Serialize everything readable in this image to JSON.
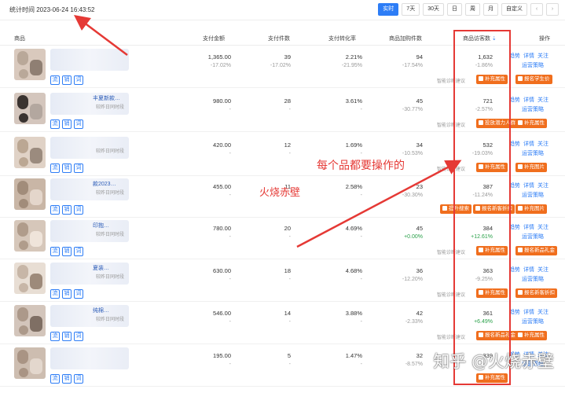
{
  "header": {
    "stat_time": "统计时间 2023-06-24 16:43:52",
    "tabs": [
      "实时",
      "7天",
      "30天",
      "日",
      "周",
      "月",
      "自定义"
    ],
    "active_tab": "实时"
  },
  "table": {
    "columns": [
      "商品",
      "支付金额",
      "支付件数",
      "支付转化率",
      "商品加购件数",
      "商品访客数",
      "操作"
    ]
  },
  "rows": [
    {
      "name": "",
      "desc": "",
      "amount": "1,365.00",
      "amount_chg": "-17.02%",
      "count": "39",
      "count_chg": "-17.02%",
      "rate": "2.21%",
      "rate_chg": "-21.95%",
      "cart": "94",
      "cart_chg": "-17.54%",
      "visitors": "1,632",
      "visitors_chg": "-1.86%",
      "suggest_label": "智能诊断建议",
      "btn1": "补充属性",
      "btn2": "报名学生价",
      "ops": [
        "趋势",
        "详情",
        "关注"
      ],
      "ops2": "运营策略"
    },
    {
      "name": "丰夏新款…",
      "desc": "较昨日同时段",
      "amount": "980.00",
      "amount_chg": "-",
      "count": "28",
      "count_chg": "-",
      "rate": "3.61%",
      "rate_chg": "-",
      "cart": "45",
      "cart_chg": "-30.77%",
      "visitors": "721",
      "visitors_chg": "-2.57%",
      "suggest_label": "智能诊断建议",
      "btn1": "投放潜力人群",
      "btn2": "补充属性",
      "ops": [
        "趋势",
        "详情",
        "关注"
      ],
      "ops2": "运营策略"
    },
    {
      "name": "",
      "desc": "较昨日同时段",
      "amount": "420.00",
      "amount_chg": "-",
      "count": "12",
      "count_chg": "-",
      "rate": "1.69%",
      "rate_chg": "-",
      "cart": "34",
      "cart_chg": "-10.53%",
      "visitors": "532",
      "visitors_chg": "-19.03%",
      "suggest_label": "智能诊断建议",
      "btn1": "补充属性",
      "btn2": "补充图片",
      "ops": [
        "趋势",
        "详情",
        "关注"
      ],
      "ops2": "运营策略"
    },
    {
      "name": "款2023…",
      "desc": "较昨日同时段",
      "amount": "455.00",
      "amount_chg": "-",
      "count": "11",
      "count_chg": "-",
      "rate": "2.58%",
      "rate_chg": "-",
      "cart": "23",
      "cart_chg": "-30.30%",
      "visitors": "387",
      "visitors_chg": "-11.24%",
      "suggest_label": "",
      "btn1": "提升搜索",
      "btn2": "报名新客折扣",
      "btn3": "补充图片",
      "ops": [
        "趋势",
        "详情",
        "关注"
      ],
      "ops2": "运营策略"
    },
    {
      "name": "印抱…",
      "desc": "较昨日同时段",
      "amount": "780.00",
      "amount_chg": "-",
      "count": "20",
      "count_chg": "-",
      "rate": "4.69%",
      "rate_chg": "-",
      "cart": "45",
      "cart_chg": "+0.00%",
      "visitors": "384",
      "visitors_chg": "+12.61%",
      "suggest_label": "智能诊断建议",
      "btn1": "补充属性",
      "btn2": "报名新品礼金",
      "ops": [
        "趋势",
        "详情",
        "关注"
      ],
      "ops2": "运营策略"
    },
    {
      "name": "夏装…",
      "desc": "较昨日同时段",
      "amount": "630.00",
      "amount_chg": "-",
      "count": "18",
      "count_chg": "-",
      "rate": "4.68%",
      "rate_chg": "-",
      "cart": "36",
      "cart_chg": "-12.20%",
      "visitors": "363",
      "visitors_chg": "-9.25%",
      "suggest_label": "智能诊断建议",
      "btn1": "补充属性",
      "btn2": "报名新客折扣",
      "ops": [
        "趋势",
        "详情",
        "关注"
      ],
      "ops2": "运营策略"
    },
    {
      "name": "纯棉…",
      "desc": "较昨日同时段",
      "amount": "546.00",
      "amount_chg": "-",
      "count": "14",
      "count_chg": "-",
      "rate": "3.88%",
      "rate_chg": "-",
      "cart": "42",
      "cart_chg": "-2.33%",
      "visitors": "361",
      "visitors_chg": "+6.49%",
      "suggest_label": "智能诊断建议",
      "btn1": "报名新品礼金",
      "btn2": "补充属性",
      "ops": [
        "趋势",
        "详情",
        "关注"
      ],
      "ops2": "运营策略"
    },
    {
      "name": "",
      "desc": "",
      "amount": "195.00",
      "amount_chg": "-",
      "count": "5",
      "count_chg": "-",
      "rate": "1.47%",
      "rate_chg": "-",
      "cart": "32",
      "cart_chg": "-8.57%",
      "visitors": "339",
      "visitors_chg": "",
      "suggest_label": "",
      "btn1": "补充属性",
      "btn2": "",
      "ops": [
        "趋势",
        "详情",
        "关注"
      ],
      "ops2": "运营策略"
    }
  ],
  "row_tags": [
    "流",
    "销",
    "词"
  ],
  "annotations": {
    "text1": "每个品都要操作的",
    "text2": "火烧赤壁",
    "watermark": "知乎 @火烧赤壁"
  },
  "colors": {
    "accent": "#2d7df6",
    "button_orange": "#f06e1d",
    "annotation_red": "#e53935"
  }
}
